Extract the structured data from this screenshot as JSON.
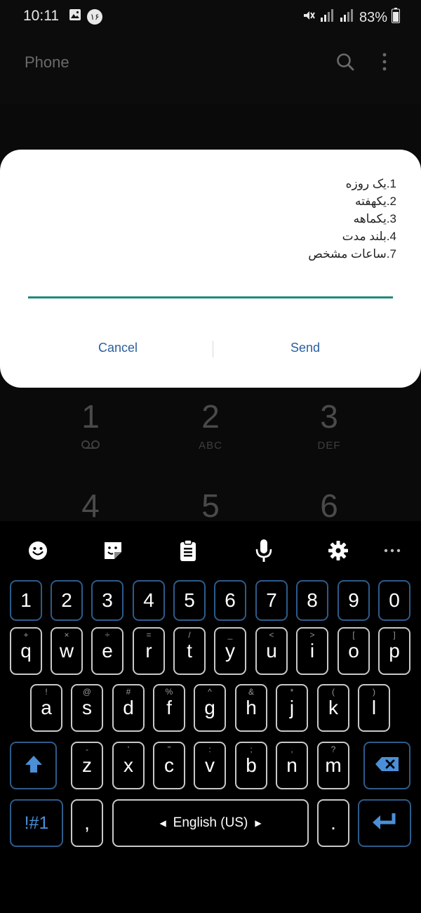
{
  "status_bar": {
    "time": "10:11",
    "notification_badge": "۱۶",
    "battery": "83%"
  },
  "app_bar": {
    "title": "Phone"
  },
  "dialpad": [
    {
      "digit": "1",
      "letters": ""
    },
    {
      "digit": "2",
      "letters": "ABC"
    },
    {
      "digit": "3",
      "letters": "DEF"
    },
    {
      "digit": "4",
      "letters": ""
    },
    {
      "digit": "5",
      "letters": ""
    },
    {
      "digit": "6",
      "letters": ""
    }
  ],
  "dialog": {
    "lines": [
      "1.یک روزه",
      "2.یکهفته",
      "3.یکماهه",
      "4.بلند مدت",
      "7.ساعات مشخص"
    ],
    "input_value": "",
    "cancel_label": "Cancel",
    "send_label": "Send"
  },
  "keyboard": {
    "numbers": [
      "1",
      "2",
      "3",
      "4",
      "5",
      "6",
      "7",
      "8",
      "9",
      "0"
    ],
    "row1": [
      {
        "key": "q",
        "hint": "+"
      },
      {
        "key": "w",
        "hint": "×"
      },
      {
        "key": "e",
        "hint": "÷"
      },
      {
        "key": "r",
        "hint": "="
      },
      {
        "key": "t",
        "hint": "/"
      },
      {
        "key": "y",
        "hint": "_"
      },
      {
        "key": "u",
        "hint": "<"
      },
      {
        "key": "i",
        "hint": ">"
      },
      {
        "key": "o",
        "hint": "["
      },
      {
        "key": "p",
        "hint": "]"
      }
    ],
    "row2": [
      {
        "key": "a",
        "hint": "!"
      },
      {
        "key": "s",
        "hint": "@"
      },
      {
        "key": "d",
        "hint": "#"
      },
      {
        "key": "f",
        "hint": "%"
      },
      {
        "key": "g",
        "hint": "^"
      },
      {
        "key": "h",
        "hint": "&"
      },
      {
        "key": "j",
        "hint": "*"
      },
      {
        "key": "k",
        "hint": "("
      },
      {
        "key": "l",
        "hint": ")"
      }
    ],
    "row3": [
      {
        "key": "z",
        "hint": "-"
      },
      {
        "key": "x",
        "hint": "'"
      },
      {
        "key": "c",
        "hint": "\""
      },
      {
        "key": "v",
        "hint": ":"
      },
      {
        "key": "b",
        "hint": ";"
      },
      {
        "key": "n",
        "hint": ","
      },
      {
        "key": "m",
        "hint": "?"
      }
    ],
    "symbols_label": "!#1",
    "comma_label": ",",
    "space_label": "English (US)",
    "period_label": "."
  },
  "colors": {
    "accent": "#1f8a7f",
    "button_text": "#2a5f9e",
    "key_border_blue": "#2d5b8a",
    "key_icon_blue": "#4a8fd8"
  }
}
